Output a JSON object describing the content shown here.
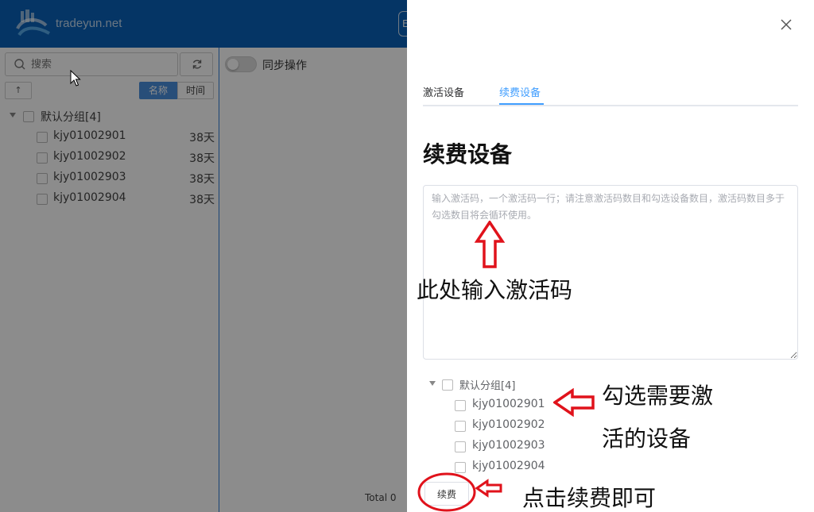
{
  "header": {
    "logo_text": "tradeyun.net",
    "chip_label": "E"
  },
  "left_panel": {
    "search_placeholder": "搜索",
    "sort_label": "↑",
    "sort_name": "名称",
    "sort_time": "时间",
    "group_label": "默认分组[4]",
    "devices": [
      {
        "name": "kjy01002901",
        "days": "38天"
      },
      {
        "name": "kjy01002902",
        "days": "38天"
      },
      {
        "name": "kjy01002903",
        "days": "38天"
      },
      {
        "name": "kjy01002904",
        "days": "38天"
      }
    ]
  },
  "main": {
    "sync_label": "同步操作",
    "total_label": "Total 0"
  },
  "drawer": {
    "tabs": [
      {
        "label": "激活设备"
      },
      {
        "label": "续费设备"
      }
    ],
    "title": "续费设备",
    "code_placeholder": "输入激活码，一个激活码一行；请注意激活码数目和勾选设备数目，激活码数目多于勾选数目将会循环使用。",
    "group_label": "默认分组[4]",
    "devices": [
      {
        "name": "kjy01002901"
      },
      {
        "name": "kjy01002902"
      },
      {
        "name": "kjy01002903"
      },
      {
        "name": "kjy01002904"
      }
    ],
    "renew_button": "续费"
  },
  "annotations": {
    "input_hint": "此处输入激活码",
    "select_hint_line1": "勾选需要激",
    "select_hint_line2": "活的设备",
    "click_hint": "点击续费即可"
  },
  "colors": {
    "topbar": "#0a62b8",
    "accent": "#409eff",
    "annotation_red": "#e0121b"
  }
}
